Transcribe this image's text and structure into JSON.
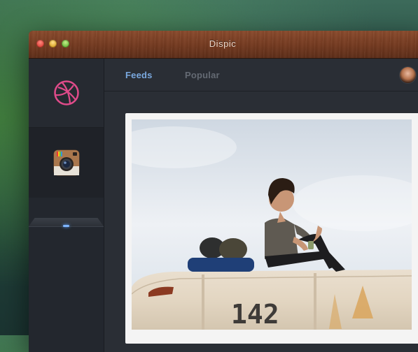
{
  "window": {
    "title": "Dispic"
  },
  "sidebar": {
    "items": [
      {
        "name": "dribbble",
        "icon": "dribbble-icon",
        "color": "#e04b8a"
      },
      {
        "name": "instagram",
        "icon": "instagram-icon",
        "active": true
      }
    ]
  },
  "tabs": [
    {
      "label": "Feeds",
      "active": true
    },
    {
      "label": "Popular",
      "active": false
    }
  ],
  "feed": {
    "posts": [
      {
        "image": "photo of a man sitting on top of a bus",
        "bus_number": "142"
      }
    ]
  },
  "colors": {
    "accent": "#7aa8de",
    "titlebar": "#73391f",
    "sidebar": "#23272e"
  }
}
